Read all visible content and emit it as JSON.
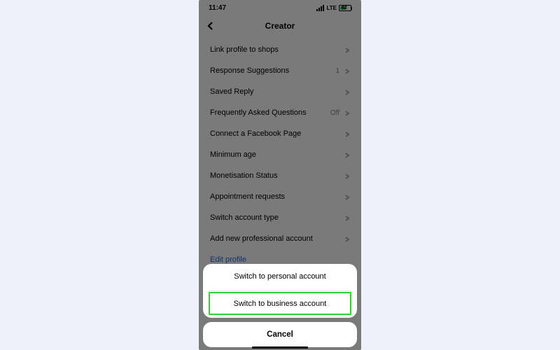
{
  "status": {
    "time": "11:47",
    "network": "LTE",
    "battery_pct": "62"
  },
  "nav": {
    "title": "Creator"
  },
  "list": {
    "items": [
      {
        "label": "Link profile to shops",
        "meta": ""
      },
      {
        "label": "Response Suggestions",
        "meta": "1"
      },
      {
        "label": "Saved Reply",
        "meta": ""
      },
      {
        "label": "Frequently Asked Questions",
        "meta": "Off"
      },
      {
        "label": "Connect a Facebook Page",
        "meta": ""
      },
      {
        "label": "Minimum age",
        "meta": ""
      },
      {
        "label": "Monetisation Status",
        "meta": ""
      },
      {
        "label": "Appointment requests",
        "meta": ""
      },
      {
        "label": "Switch account type",
        "meta": ""
      },
      {
        "label": "Add new professional account",
        "meta": ""
      }
    ],
    "link": "Edit profile"
  },
  "sheet": {
    "option_personal": "Switch to personal account",
    "option_business": "Switch to business account",
    "cancel": "Cancel"
  }
}
